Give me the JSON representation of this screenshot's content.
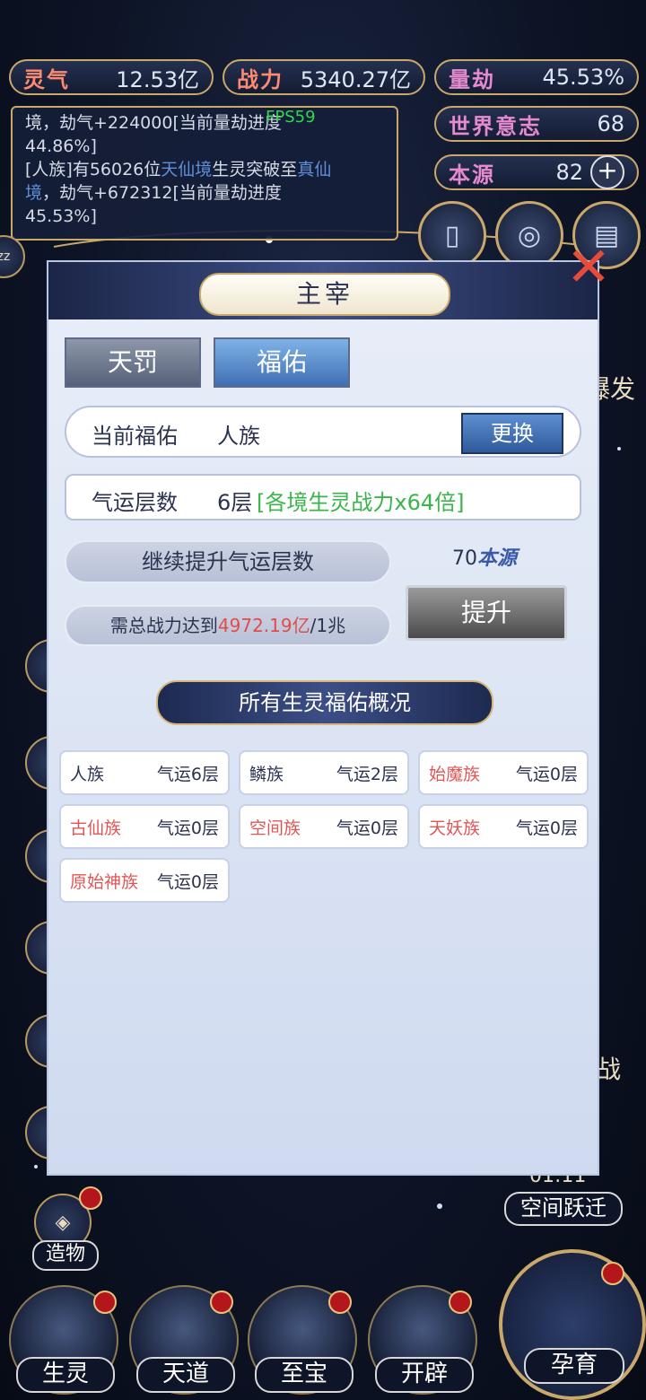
{
  "stats": {
    "lingqi": {
      "label": "灵气",
      "value": "12.53亿"
    },
    "zhanli": {
      "label": "战力",
      "value": "5340.27亿"
    },
    "liangjie": {
      "label": "量劫",
      "value": "45.53%"
    },
    "shijie": {
      "label": "世界意志",
      "value": "68"
    },
    "benyuan": {
      "label": "本源",
      "value": "82"
    }
  },
  "fps": "FPS59",
  "log": {
    "line1_a": "境，劫气+224000[当前量劫进度",
    "line1_b": "44.86%]",
    "line2_a": "[人族]有56026位",
    "line2_blue1": "天仙境",
    "line2_b": "生灵突破至",
    "line2_blue2": "真仙",
    "line3_blue": "境",
    "line3_b": "，劫气+672312[当前量劫进度",
    "line4": "45.53%]"
  },
  "side_labels": {
    "zaowu": "造物",
    "kongjian": "空间跃迁",
    "timer": "01:11",
    "baofa": "爆发",
    "zhan": "战"
  },
  "modal": {
    "title": "主宰",
    "tabs": [
      "天罚",
      "福佑"
    ],
    "current_label": "当前福佑",
    "current_value": "人族",
    "change_button": "更换",
    "qiyun_label": "气运层数",
    "qiyun_value": "6层",
    "qiyun_bonus": "[各境生灵战力x64倍]",
    "continue_label": "继续提升气运层数",
    "need_prefix": "需总战力达到",
    "need_value": "4972.19亿",
    "need_suffix": "/1兆",
    "cost_amount": "70",
    "cost_unit": "本源",
    "boost_button": "提升",
    "overview_title": "所有生灵福佑概况",
    "races": [
      {
        "name": "人族",
        "level": "气运6层",
        "red": false
      },
      {
        "name": "鳞族",
        "level": "气运2层",
        "red": false
      },
      {
        "name": "始魔族",
        "level": "气运0层",
        "red": true
      },
      {
        "name": "古仙族",
        "level": "气运0层",
        "red": true
      },
      {
        "name": "空间族",
        "level": "气运0层",
        "red": true
      },
      {
        "name": "天妖族",
        "level": "气运0层",
        "red": true
      },
      {
        "name": "原始神族",
        "level": "气运0层",
        "red": true
      }
    ]
  },
  "bottom_nav": [
    "生灵",
    "天道",
    "至宝",
    "开辟",
    "孕育"
  ]
}
